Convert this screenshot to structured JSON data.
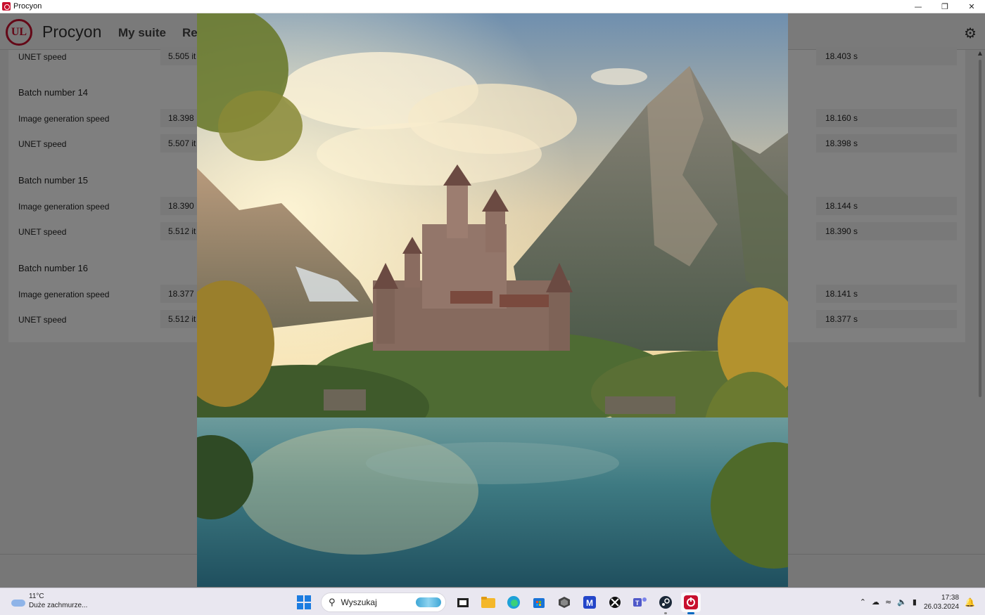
{
  "window": {
    "title": "Procyon",
    "minimize_icon": "minimize-icon",
    "restore_icon": "restore-icon",
    "close_icon": "close-icon"
  },
  "app": {
    "logo_text": "UL",
    "brand": "Procyon",
    "nav": [
      {
        "label": "My suite"
      },
      {
        "label": "Re"
      }
    ],
    "settings_icon": "gear-icon"
  },
  "results": {
    "top_row": {
      "label": "UNET speed",
      "value": "5.505 it",
      "right_value": "18.403 s"
    },
    "batches": [
      {
        "title": "Batch number 14",
        "rows": [
          {
            "label": "Image generation speed",
            "value": "18.398",
            "right_value": "18.160 s"
          },
          {
            "label": "UNET speed",
            "value": "5.507 it",
            "right_value": "18.398 s"
          }
        ]
      },
      {
        "title": "Batch number 15",
        "rows": [
          {
            "label": "Image generation speed",
            "value": "18.390",
            "right_value": "18.144 s"
          },
          {
            "label": "UNET speed",
            "value": "5.512 it",
            "right_value": "18.390 s"
          }
        ]
      },
      {
        "title": "Batch number 16",
        "rows": [
          {
            "label": "Image generation speed",
            "value": "18.377",
            "right_value": "18.141 s"
          },
          {
            "label": "UNET speed",
            "value": "5.512 it",
            "right_value": "18.377 s"
          }
        ]
      }
    ]
  },
  "overlay": {
    "image_subject": "generated-image-castle-lake-mountains"
  },
  "taskbar": {
    "weather": {
      "temp": "11°C",
      "condition": "Duże zachmurze..."
    },
    "search_placeholder": "Wyszukaj",
    "apps": [
      "start-icon",
      "search-icon",
      "task-view-icon",
      "file-explorer-icon",
      "edge-icon",
      "store-icon",
      "app-cube-icon",
      "app-m-icon",
      "xbox-icon",
      "teams-icon",
      "steam-icon",
      "procyon-icon"
    ],
    "clock": {
      "time": "17:38",
      "date": "26.03.2024"
    }
  }
}
